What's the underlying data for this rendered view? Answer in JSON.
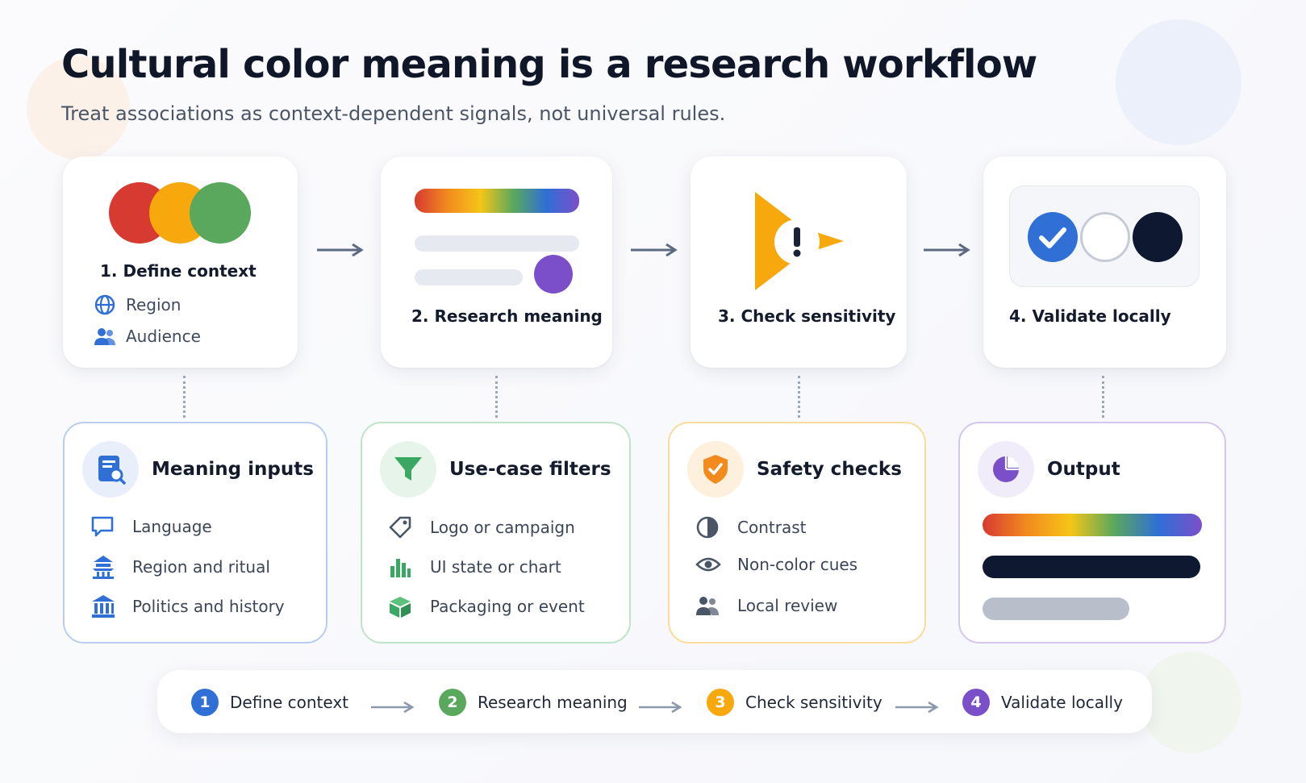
{
  "header": {
    "title": "Cultural color meaning is a research workflow",
    "subtitle": "Treat associations as context-dependent signals, not universal rules."
  },
  "colors": {
    "red": "#d63a31",
    "amber": "#f7a80d",
    "green": "#5aa85d",
    "purple": "#7b4fc9",
    "blue": "#2f6fd6",
    "navy": "#0e1830",
    "gray_bar": "#e5e8ee"
  },
  "steps": [
    {
      "label": "1. Define context",
      "details": [
        {
          "icon": "globe-icon",
          "text": "Region"
        },
        {
          "icon": "people-icon",
          "text": "Audience"
        }
      ]
    },
    {
      "label": "2. Research meaning"
    },
    {
      "label": "3. Check sensitivity"
    },
    {
      "label": "4. Validate locally"
    }
  ],
  "panels": [
    {
      "title": "Meaning inputs",
      "icon": "document-search-icon",
      "border": "#b9cdf0",
      "items": [
        {
          "icon": "speech-bubble-icon",
          "text": "Language"
        },
        {
          "icon": "pagoda-icon",
          "text": "Region and ritual"
        },
        {
          "icon": "institution-icon",
          "text": "Politics and history"
        }
      ]
    },
    {
      "title": "Use-case filters",
      "icon": "funnel-icon",
      "border": "#bfe3c8",
      "items": [
        {
          "icon": "tag-icon",
          "text": "Logo or campaign"
        },
        {
          "icon": "bar-chart-icon",
          "text": "UI state or chart"
        },
        {
          "icon": "gift-box-icon",
          "text": "Packaging or event"
        }
      ]
    },
    {
      "title": "Safety checks",
      "icon": "shield-check-icon",
      "border": "#f9dc9a",
      "items": [
        {
          "icon": "contrast-icon",
          "text": "Contrast"
        },
        {
          "icon": "eye-icon",
          "text": "Non-color cues"
        },
        {
          "icon": "people-icon",
          "text": "Local review"
        }
      ]
    },
    {
      "title": "Output",
      "icon": "pie-chart-icon",
      "border": "#d4c6ee"
    }
  ],
  "summary": [
    {
      "num": "1",
      "label": "Define context",
      "color": "#2f6fd6"
    },
    {
      "num": "2",
      "label": "Research meaning",
      "color": "#5aa85d"
    },
    {
      "num": "3",
      "label": "Check sensitivity",
      "color": "#f7a80d"
    },
    {
      "num": "4",
      "label": "Validate locally",
      "color": "#7b4fc9"
    }
  ]
}
